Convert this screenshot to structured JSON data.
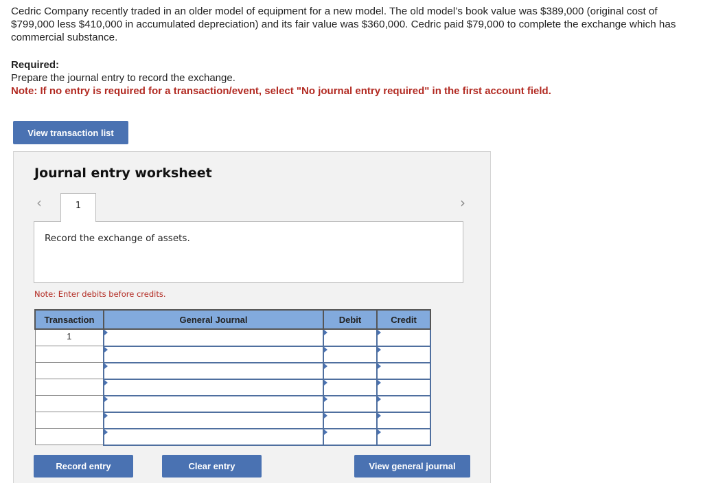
{
  "problem": {
    "text": "Cedric Company recently traded in an older model of equipment for a new model. The old model’s book value was $389,000 (original cost of $799,000 less $410,000 in accumulated depreciation) and its fair value was $360,000. Cedric paid $79,000 to complete the exchange which has commercial substance."
  },
  "required": {
    "heading": "Required:",
    "instruction": "Prepare the journal entry to record the exchange.",
    "note": "Note: If no entry is required for a transaction/event, select \"No journal entry required\" in the first account field."
  },
  "buttons": {
    "view_transaction_list": "View transaction list",
    "record_entry": "Record entry",
    "clear_entry": "Clear entry",
    "view_general_journal": "View general journal"
  },
  "worksheet": {
    "title": "Journal entry worksheet",
    "prev_icon": "‹",
    "next_icon": "›",
    "tabs": [
      {
        "label": "1"
      }
    ],
    "description": "Record the exchange of assets.",
    "note": "Note: Enter debits before credits.",
    "table": {
      "headers": [
        "Transaction",
        "General Journal",
        "Debit",
        "Credit"
      ],
      "rows": [
        {
          "transaction": "1",
          "account": "",
          "debit": "",
          "credit": ""
        },
        {
          "transaction": "",
          "account": "",
          "debit": "",
          "credit": ""
        },
        {
          "transaction": "",
          "account": "",
          "debit": "",
          "credit": ""
        },
        {
          "transaction": "",
          "account": "",
          "debit": "",
          "credit": ""
        },
        {
          "transaction": "",
          "account": "",
          "debit": "",
          "credit": ""
        },
        {
          "transaction": "",
          "account": "",
          "debit": "",
          "credit": ""
        },
        {
          "transaction": "",
          "account": "",
          "debit": "",
          "credit": ""
        }
      ]
    }
  },
  "colors": {
    "button": "#4a72b2",
    "note_red": "#b22a22",
    "table_header": "#82aadd"
  }
}
